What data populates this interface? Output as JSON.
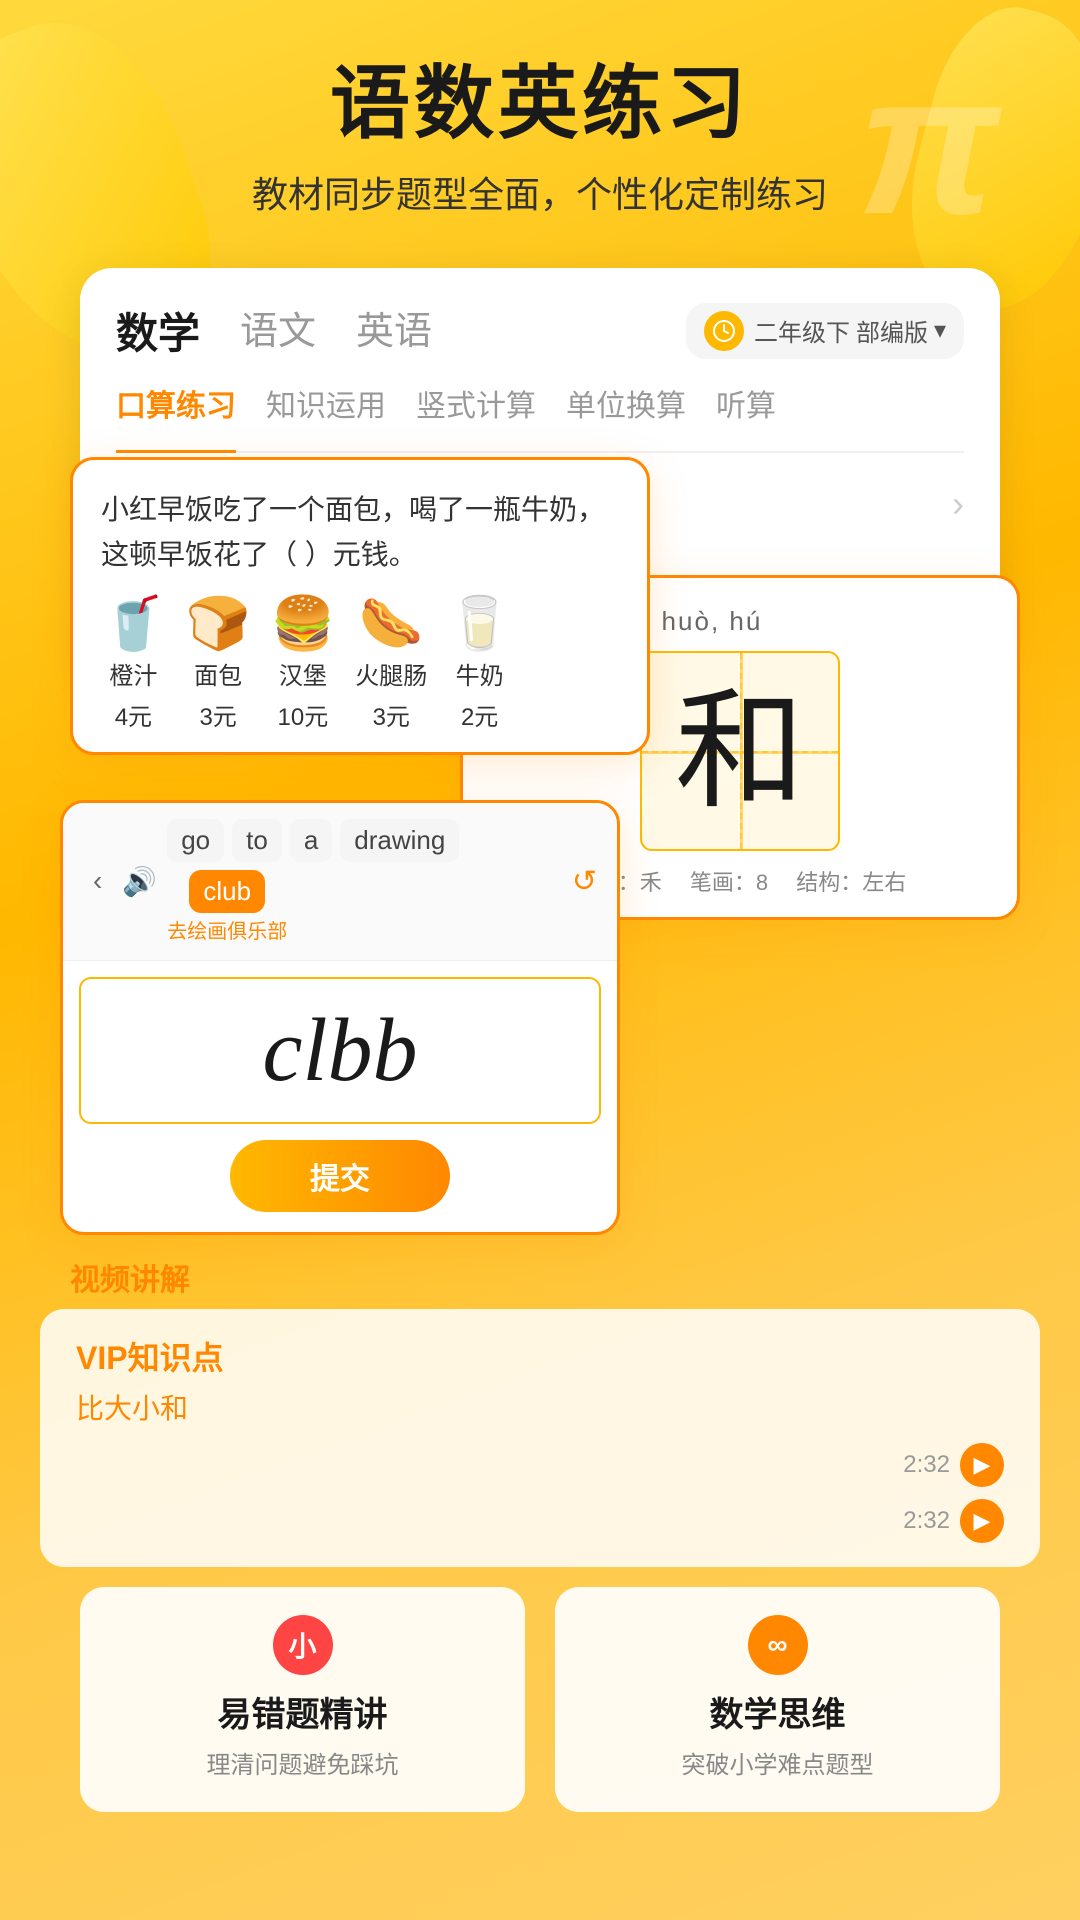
{
  "header": {
    "title": "语数英练习",
    "subtitle": "教材同步题型全面，个性化定制练习"
  },
  "math_card": {
    "tabs": [
      "数学",
      "语文",
      "英语"
    ],
    "active_tab": "数学",
    "grade": "二年级下",
    "edition": "部编版",
    "sub_tabs": [
      "口算练习",
      "知识运用",
      "竖式计算",
      "单位换算",
      "听算"
    ],
    "active_sub_tab": "口算练习"
  },
  "question_card": {
    "text": "小红早饭吃了一个面包，喝了一瓶牛奶，这顿早饭花了（  ）元钱。",
    "foods": [
      {
        "name": "橙汁",
        "price": "4元",
        "emoji": "🥤"
      },
      {
        "name": "面包",
        "price": "3元",
        "emoji": "🍞"
      },
      {
        "name": "汉堡",
        "price": "10元",
        "emoji": "🍔"
      },
      {
        "name": "火腿肠",
        "price": "3元",
        "emoji": "🌭"
      },
      {
        "name": "牛奶",
        "price": "2元",
        "emoji": "🥛"
      }
    ]
  },
  "chinese_card": {
    "pinyin": "hé, hè, huó, huò, hú",
    "character": "和",
    "radical": "禾",
    "strokes": "8",
    "structure": "左右"
  },
  "english_card": {
    "words": [
      "go",
      "to",
      "a",
      "drawing",
      "club"
    ],
    "highlight_word": "club",
    "hint": "去绘画俱乐部",
    "answer": "clbb",
    "submit_label": "提交"
  },
  "vip_section": {
    "label": "VIP知识点",
    "sublabel": "比大小和",
    "timestamps": [
      "2:32",
      "2:32"
    ]
  },
  "video_label": "视频讲解",
  "bottom_cards": [
    {
      "title": "易错题精讲",
      "desc": "理清问题避免踩坑",
      "icon": "小",
      "icon_color": "red"
    },
    {
      "title": "数学思维",
      "desc": "突破小学难点题型",
      "icon": "∞",
      "icon_color": "orange"
    }
  ],
  "decorations": {
    "pi_symbol": "π",
    "back_arrow": "‹"
  }
}
